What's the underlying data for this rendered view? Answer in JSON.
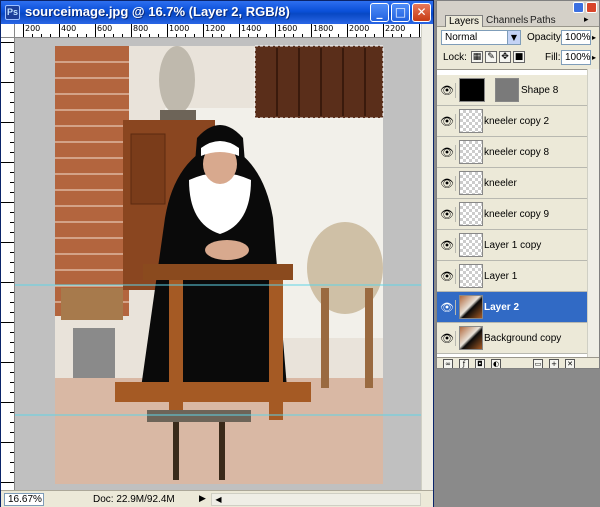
{
  "window": {
    "title": "sourceimage.jpg @ 16.7% (Layer 2, RGB/8)",
    "icon_label": "Ps",
    "buttons": {
      "minimize": "_",
      "maximize": "□",
      "close": "✕"
    }
  },
  "rulers": {
    "horizontal_labels": [
      "200",
      "400",
      "600",
      "800",
      "1000",
      "1200",
      "1400",
      "1600",
      "1800",
      "2000",
      "2200"
    ]
  },
  "status": {
    "zoom": "16.67%",
    "doc": "Doc: 22.9M/92.4M",
    "arrow": "▶"
  },
  "layers_panel": {
    "tabs": [
      "Layers",
      "Channels",
      "Paths"
    ],
    "active_tab": "Layers",
    "blend_mode": "Normal",
    "opacity_label": "Opacity:",
    "opacity": "100%",
    "lock_label": "Lock:",
    "fill_label": "Fill:",
    "fill": "100%",
    "layers": [
      {
        "name": "Shape 8",
        "thumb": "shape",
        "selected": false
      },
      {
        "name": "kneeler copy 2",
        "thumb": "transparent",
        "selected": false
      },
      {
        "name": "kneeler copy 8",
        "thumb": "transparent",
        "selected": false
      },
      {
        "name": "kneeler",
        "thumb": "transparent",
        "selected": false
      },
      {
        "name": "kneeler copy 9",
        "thumb": "transparent",
        "selected": false
      },
      {
        "name": "Layer 1 copy",
        "thumb": "transparent",
        "selected": false
      },
      {
        "name": "Layer 1",
        "thumb": "transparent",
        "selected": false
      },
      {
        "name": "Layer 2",
        "thumb": "photo",
        "selected": true
      },
      {
        "name": "Background copy",
        "thumb": "photo",
        "selected": false
      }
    ]
  },
  "colors": {
    "titlebar": "#0a4fd8",
    "selection": "#316ac5",
    "guide": "#5fd3e6"
  }
}
